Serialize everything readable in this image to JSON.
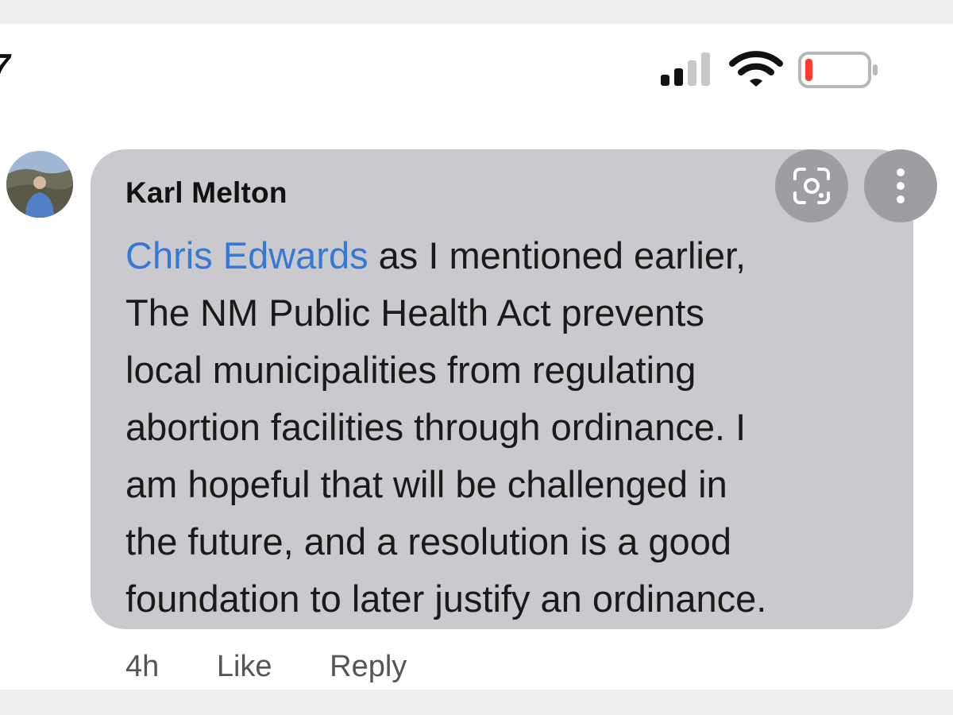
{
  "status_bar": {
    "time_fragment": "7",
    "signal_icon": "cellular-signal-icon",
    "wifi_icon": "wifi-icon",
    "battery_icon": "battery-low-icon",
    "battery_level": 0.12,
    "battery_color": "#ff3b30"
  },
  "comment": {
    "avatar_icon": "user-avatar",
    "author": "Karl Melton",
    "mention": "Chris Edwards",
    "first_line_rest": " as I mentioned earlier,",
    "lines": [
      "The NM Public Health Act prevents",
      "local municipalities from regulating",
      "abortion facilities through ordinance. I",
      "am hopeful that will be challenged in",
      "the future, and a resolution is a good",
      "foundation to later justify an ordinance."
    ],
    "timestamp": "4h",
    "like_label": "Like",
    "reply_label": "Reply",
    "mention_color": "#3579d6",
    "bubble_color": "#c9c9ce"
  },
  "overlay_buttons": {
    "scan_icon": "visual-lookup-icon",
    "more_icon": "more-vertical-icon"
  }
}
